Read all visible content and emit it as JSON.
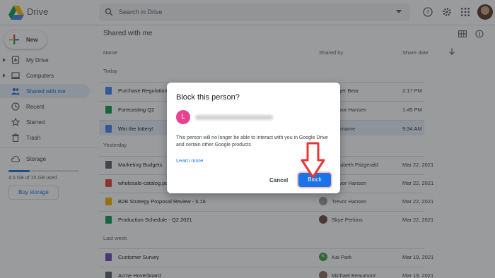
{
  "header": {
    "brand": "Drive",
    "search_placeholder": "Search in Drive",
    "icons": [
      "drive-logo",
      "search-icon",
      "caret-down-icon",
      "help-icon",
      "gear-icon",
      "apps-icon",
      "avatar"
    ]
  },
  "sidebar": {
    "new_label": "New",
    "items": [
      {
        "label": "My Drive",
        "icon": "my-drive-icon",
        "arrow": true
      },
      {
        "label": "Computers",
        "icon": "computer-icon",
        "arrow": true
      },
      {
        "label": "Shared with me",
        "icon": "people-icon",
        "active": true
      },
      {
        "label": "Recent",
        "icon": "clock-icon"
      },
      {
        "label": "Starred",
        "icon": "star-icon"
      },
      {
        "label": "Trash",
        "icon": "trash-icon"
      }
    ],
    "storage": {
      "label": "Storage",
      "icon": "cloud-icon",
      "usage": "4.5 GB of 15 GB used",
      "fraction": 0.3,
      "buy_label": "Buy storage"
    }
  },
  "main": {
    "title": "Shared with me",
    "columns": {
      "name": "Name",
      "shared_by": "Shared by",
      "share_date": "Share date"
    },
    "sections": [
      {
        "label": "Today",
        "rows": [
          {
            "name": "Purchase Regulations",
            "type": "doc",
            "shared_by": "Roger Bear",
            "date": "2:17 PM",
            "avatar": "#8d6e63"
          },
          {
            "name": "Forecasting Q2",
            "type": "sheet",
            "shared_by": "Trevor Hansen",
            "date": "1:45 PM",
            "avatar": "#9e9e9e"
          },
          {
            "name": "Win the lottery!",
            "type": "doc",
            "shared_by": "username",
            "date": "9:34 AM",
            "avatar": "#e8428e",
            "selected": true
          }
        ]
      },
      {
        "label": "Yesterday",
        "rows": [
          {
            "name": "Marketing Budgets",
            "type": "folder",
            "shared_by": "Elizabeth Fitzgerald",
            "date": "Mar 22, 2021",
            "avatar": "#a1887f"
          },
          {
            "name": "wholesale-catalog.pdf",
            "type": "pdf",
            "shared_by": "Trevor Hansen",
            "date": "Mar 22, 2021",
            "avatar": "#9e9e9e"
          },
          {
            "name": "B2B Strategy Proposal Review - 5.16",
            "type": "slide",
            "shared_by": "Trevor Hansen",
            "date": "Mar 22, 2021",
            "avatar": "#9e9e9e"
          },
          {
            "name": "Production Schedule - Q2 2021",
            "type": "sheet",
            "shared_by": "Skye Perkins",
            "date": "Mar 22, 2021",
            "avatar": "#6d4c41"
          }
        ]
      },
      {
        "label": "Last week",
        "rows": [
          {
            "name": "Customer Survey",
            "type": "form",
            "shared_by": "Kai Park",
            "date": "Mar 19, 2021",
            "avatar": "#43a047",
            "avatar_letter": "K"
          },
          {
            "name": "Acme Hoverboard",
            "type": "folder",
            "shared_by": "Michael Beaumont",
            "date": "Mar 19, 2021",
            "avatar": "#8d6e63"
          }
        ]
      }
    ]
  },
  "dialog": {
    "title": "Block this person?",
    "avatar_letter": "L",
    "description": "This person will no longer be able to interact with you in Google Drive and certain other Google products",
    "learn_more": "Learn more",
    "cancel_label": "Cancel",
    "block_label": "Block"
  },
  "colors": {
    "accent": "#1a73e8",
    "active_bg": "#e8f0fe",
    "arrow": "#e53935"
  }
}
